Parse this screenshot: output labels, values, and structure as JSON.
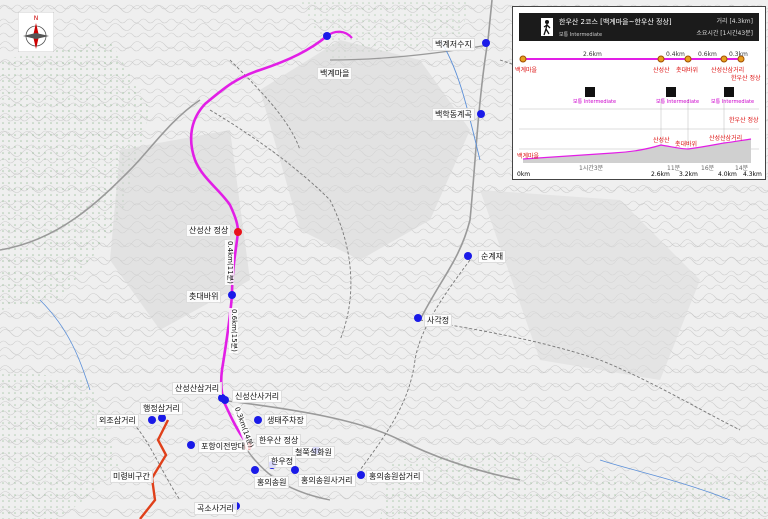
{
  "map": {
    "route_color": "#e21ee6",
    "alt_route_color": "#e0401a",
    "poi_color": "#1a1ae8",
    "highlight_color": "#e8121a",
    "compass_label": "N",
    "pois": [
      {
        "name": "백계저수지",
        "icon": "blue-dot"
      },
      {
        "name": "백계마을",
        "icon": "blue-dot"
      },
      {
        "name": "백학동계곡",
        "icon": "blue-dot"
      },
      {
        "name": "산성산 정상",
        "icon": "red-dot"
      },
      {
        "name": "순계재",
        "icon": "blue-dot"
      },
      {
        "name": "촛대바위",
        "icon": "blue-dot"
      },
      {
        "name": "사각정",
        "icon": "blue-dot"
      },
      {
        "name": "산성산삼거리",
        "icon": "blue-dot"
      },
      {
        "name": "신성산사거리",
        "icon": "blue-dot"
      },
      {
        "name": "행정삼거리",
        "icon": "blue-dot"
      },
      {
        "name": "외조삼거리",
        "icon": "blue-dot"
      },
      {
        "name": "생태주차장",
        "icon": "blue-dot"
      },
      {
        "name": "한우산 정상",
        "icon": "red-dot"
      },
      {
        "name": "포항이전망대",
        "icon": "blue-dot"
      },
      {
        "name": "철쭉설화원",
        "icon": "blue-dot"
      },
      {
        "name": "한우정",
        "icon": "blue-dot"
      },
      {
        "name": "홍의송원",
        "icon": "blue-dot"
      },
      {
        "name": "홍의송원사거리",
        "icon": "blue-dot"
      },
      {
        "name": "홍의송원삼거리",
        "icon": "blue-dot"
      },
      {
        "name": "미령비구간",
        "icon": "none"
      },
      {
        "name": "곡소사거리",
        "icon": "blue-dot"
      }
    ],
    "segment_labels": [
      "0.4km(11분)",
      "0.6km(15분)",
      "0.3km(14분)"
    ]
  },
  "panel": {
    "title": "한우산 2코스 [백계마을~한우산 정상]",
    "level": "보통 Intermediate",
    "distance": "거리 [4.3km]",
    "time": "소요시간 [1시간43분]",
    "points": [
      "백계마을",
      "산성산",
      "촛대바위",
      "산성산삼거리",
      "한우산 정상"
    ],
    "segments": [
      "2.6km",
      "0.4km",
      "0.6km",
      "0.3km"
    ],
    "profile_points": [
      "백계마을",
      "산성산",
      "촛대바위",
      "산성산삼거리",
      "한우산 정상"
    ],
    "level_icons": [
      {
        "label": "보통 Intermediate"
      },
      {
        "label": "보통 Intermediate"
      },
      {
        "label": "보통 Intermediate"
      }
    ],
    "km_ticks": [
      "0km",
      "2.6km",
      "3.2km",
      "4.0km",
      "4.3km"
    ],
    "time_ticks": [
      "1시간3분",
      "11분",
      "16분",
      "14분"
    ]
  }
}
